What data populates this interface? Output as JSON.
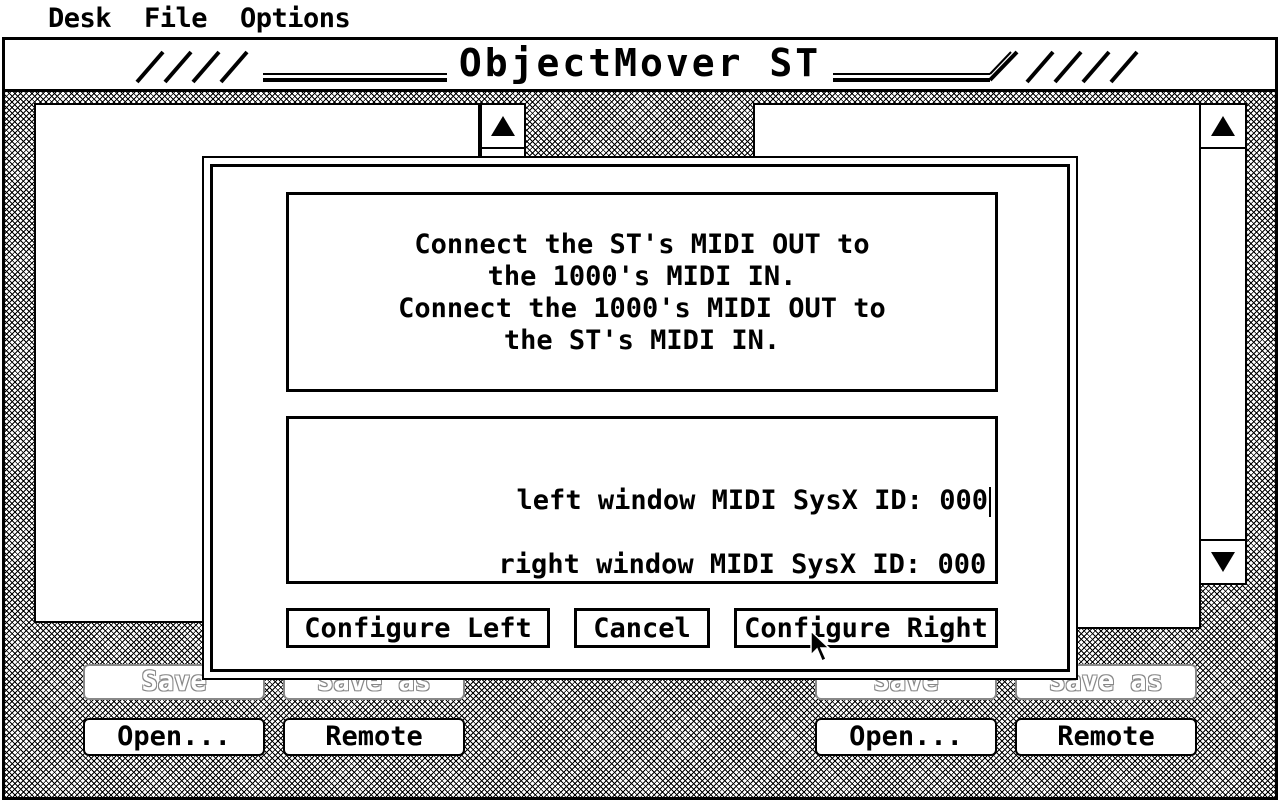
{
  "menubar": {
    "items": [
      "Desk",
      "File",
      "Options"
    ]
  },
  "window": {
    "title": "ObjectMover ST"
  },
  "left_buttons": {
    "save": "Save",
    "save_as": "Save as",
    "open": "Open...",
    "remote": "Remote"
  },
  "right_buttons": {
    "save": "Save",
    "save_as": "Save as",
    "open": "Open...",
    "remote": "Remote"
  },
  "dialog": {
    "message_lines": [
      "Connect the ST's MIDI OUT to",
      "the 1000's MIDI IN.",
      "Connect the 1000's MIDI OUT to",
      "the ST's MIDI IN."
    ],
    "left_id_label": "left window MIDI SysX ID: ",
    "left_id_value": "000",
    "right_id_label": "right window MIDI SysX ID: ",
    "right_id_value": "000",
    "buttons": {
      "configure_left": "Configure Left",
      "cancel": "Cancel",
      "configure_right": "Configure Right"
    }
  },
  "icons": {
    "scroll_up": "up-arrow-icon",
    "scroll_down": "down-arrow-icon",
    "mouse_pointer": "arrow-cursor-icon"
  }
}
